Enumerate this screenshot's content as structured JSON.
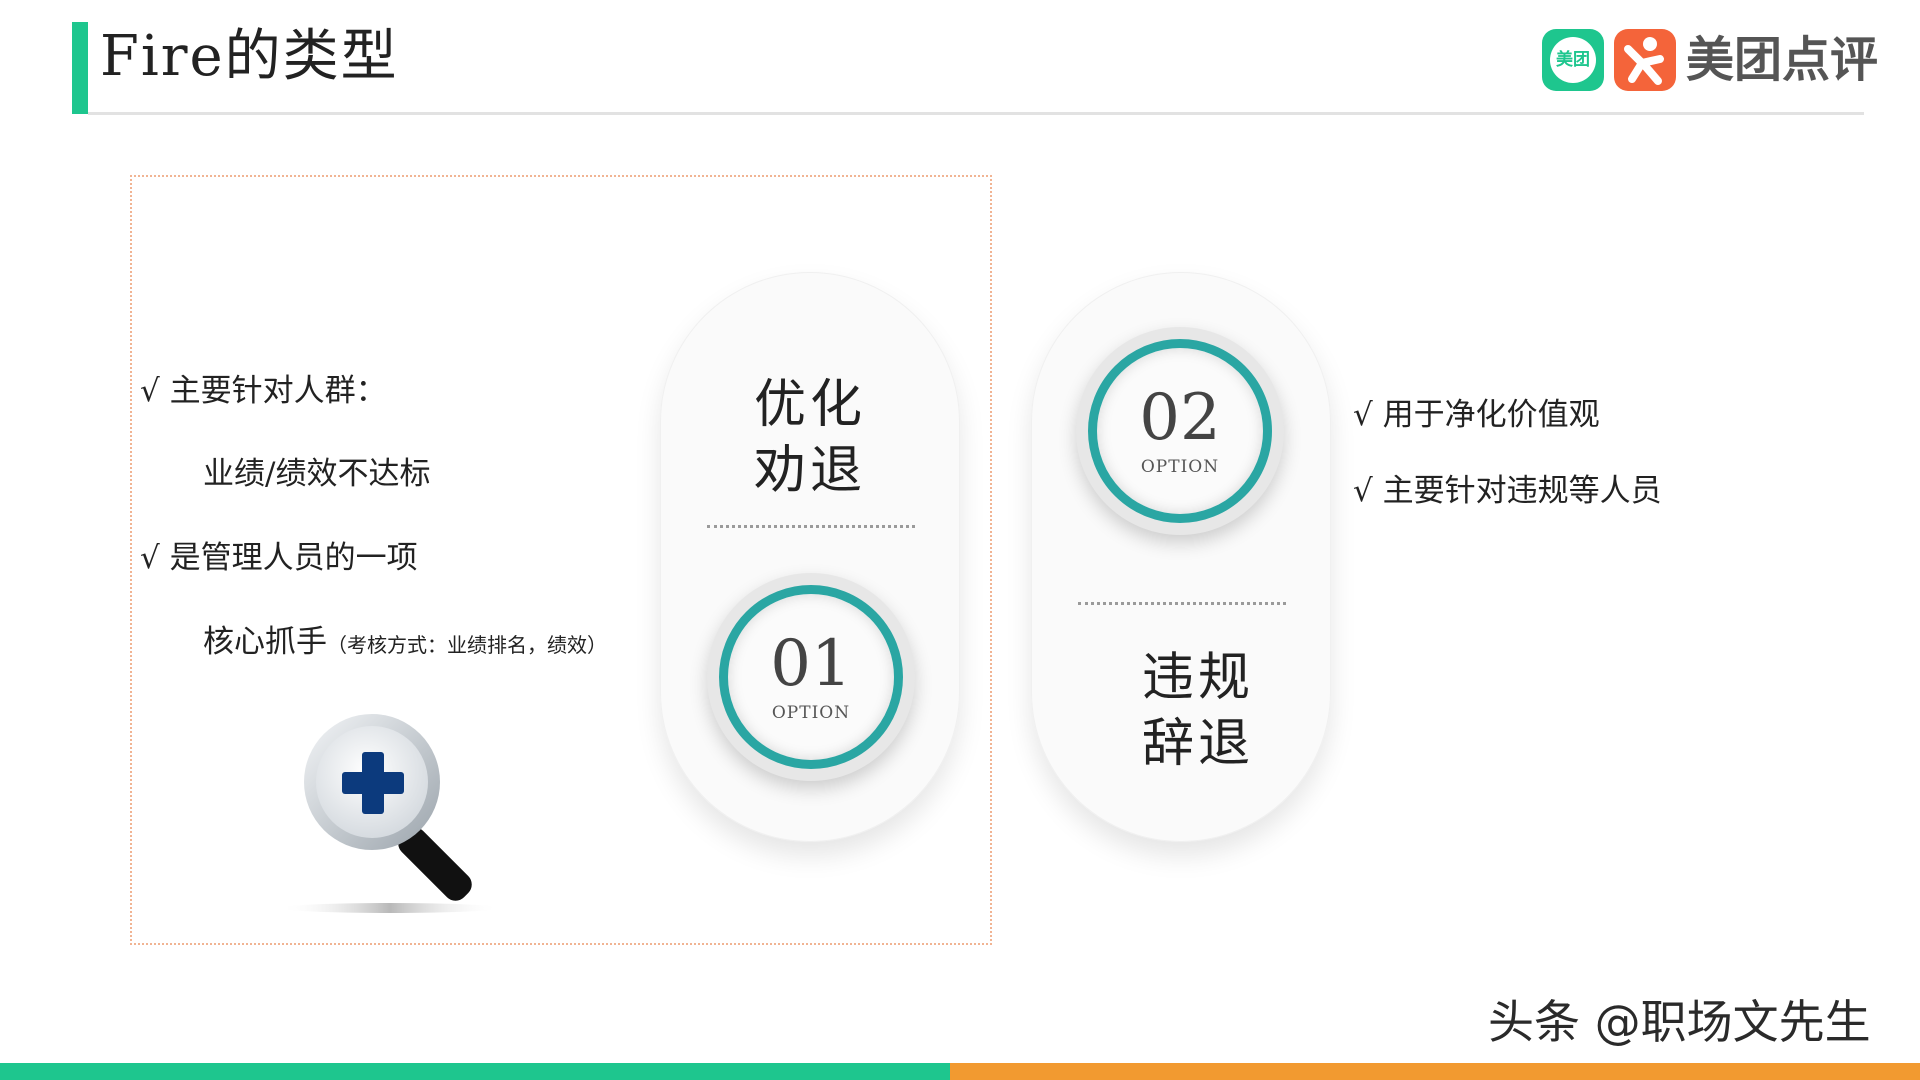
{
  "header": {
    "title": "Fire的类型"
  },
  "logo": {
    "badge_text": "美团",
    "brand_text": "美团点评"
  },
  "left_panel": {
    "line1": "√  主要针对人群：",
    "line2": "业绩/绩效不达标",
    "line3": "√  是管理人员的一项",
    "line4_main": "核心抓手",
    "line4_note": "（考核方式：业绩排名，绩效）"
  },
  "option1": {
    "title_line1": "优化",
    "title_line2": "劝退",
    "number": "01",
    "label": "OPTION"
  },
  "option2": {
    "number": "02",
    "label": "OPTION",
    "title_line1": "违规",
    "title_line2": "辞退"
  },
  "right_panel": {
    "line1": "√ 用于净化价值观",
    "line2": "√  主要针对违规等人员"
  },
  "watermark": "头条 @职场文先生",
  "colors": {
    "green": "#1ec68e",
    "orange": "#f29a30",
    "teal": "#2aa6a3",
    "logo_red": "#f4643a"
  }
}
